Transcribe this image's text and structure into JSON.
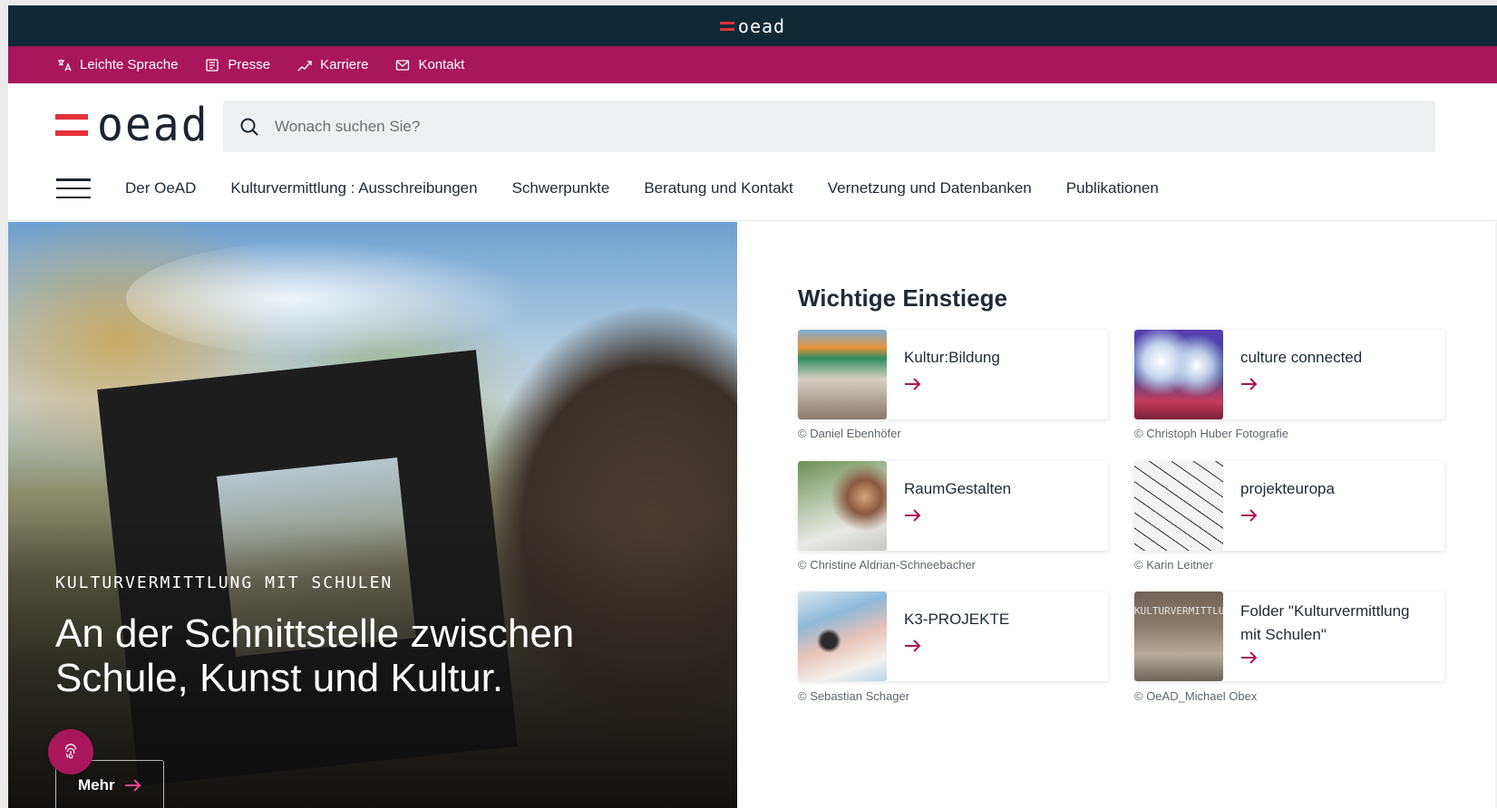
{
  "topbar": {
    "logo_text": "oead"
  },
  "utility": [
    {
      "label": "Leichte Sprache",
      "icon": "translate-icon"
    },
    {
      "label": "Presse",
      "icon": "newspaper-icon"
    },
    {
      "label": "Karriere",
      "icon": "career-icon"
    },
    {
      "label": "Kontakt",
      "icon": "mail-icon"
    }
  ],
  "header": {
    "logo_text": "oead",
    "search_placeholder": "Wonach suchen Sie?"
  },
  "nav": [
    "Der OeAD",
    "Kulturvermittlung : Ausschreibungen",
    "Schwerpunkte",
    "Beratung und Kontakt",
    "Vernetzung und Datenbanken",
    "Publikationen"
  ],
  "hero": {
    "kicker": "KULTURVERMITTLUNG MIT SCHULEN",
    "title": "An der Schnittstelle zwischen Schule, Kunst und Kultur.",
    "button": "Mehr"
  },
  "panel": {
    "title": "Wichtige Einstiege",
    "cards": [
      {
        "label": "Kultur:Bildung",
        "credit": "© Daniel Ebenhöfer"
      },
      {
        "label": "culture connected",
        "credit": "© Christoph Huber Fotografie"
      },
      {
        "label": "RaumGestalten",
        "credit": "© Christine Aldrian-Schneebacher"
      },
      {
        "label": "projekteuropa",
        "credit": "© Karin Leitner"
      },
      {
        "label": "K3-PROJEKTE",
        "credit": "© Sebastian Schager"
      },
      {
        "label": "Folder \"Kulturvermittlung mit Schulen\"",
        "credit": "© OeAD_Michael Obex",
        "thumb_text": "KULTURVERMITTLU MIT SCHULEN"
      }
    ]
  },
  "colors": {
    "dark": "#0f2a36",
    "brand": "#a8175a",
    "flag_red": "#e3313b"
  }
}
